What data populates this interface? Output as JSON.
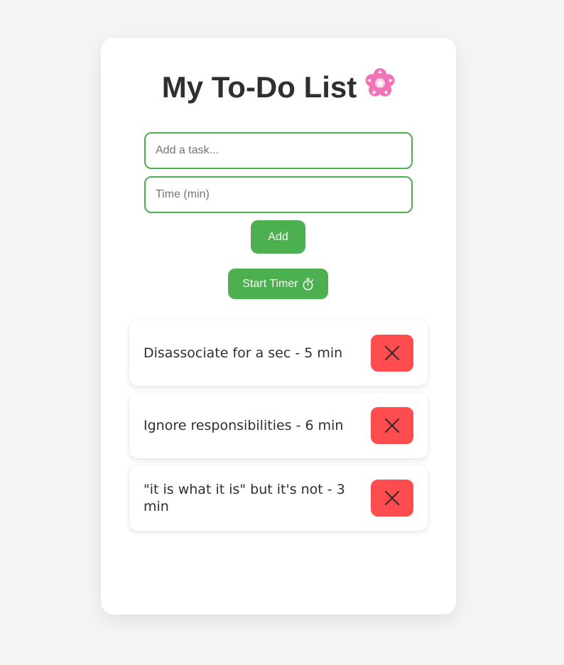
{
  "header": {
    "title": "My To-Do List",
    "title_icon": "cherry-blossom-icon"
  },
  "form": {
    "task_placeholder": "Add a task...",
    "time_placeholder": "Time (min)",
    "task_value": "",
    "time_value": "",
    "add_label": "Add",
    "timer_label": "Start Timer",
    "timer_icon": "stopwatch-icon"
  },
  "tasks": [
    {
      "text": "Disassociate for a sec - 5 min",
      "delete_icon": "close-icon"
    },
    {
      "text": "Ignore responsibilities - 6 min",
      "delete_icon": "close-icon"
    },
    {
      "text": "\"it is what it is\" but it's not - 3 min",
      "delete_icon": "close-icon"
    }
  ],
  "colors": {
    "accent": "#4caf50",
    "danger": "#ff4d4f",
    "blossom": "#f472b6",
    "background": "#f4f4f4",
    "text": "#2f2f2f"
  }
}
